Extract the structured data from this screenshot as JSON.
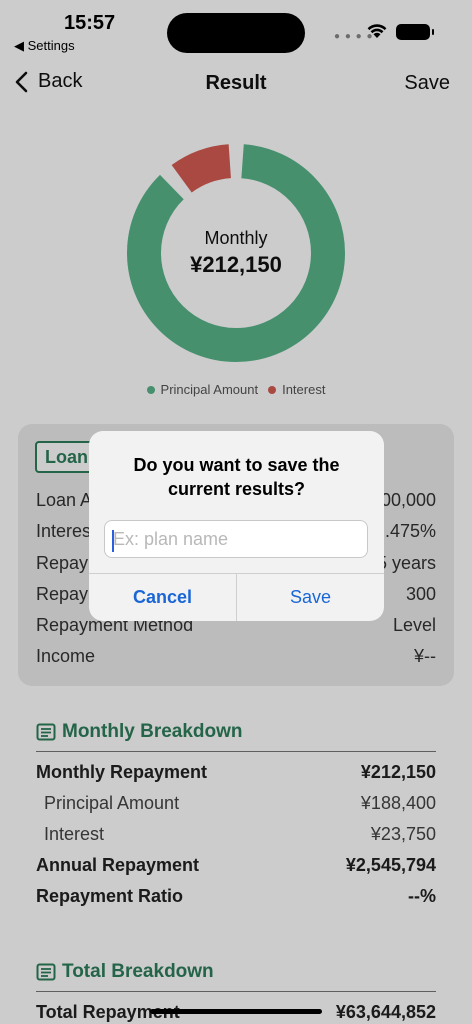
{
  "status": {
    "time": "15:57",
    "back_app": "◀ Settings"
  },
  "nav": {
    "back": "Back",
    "title": "Result",
    "save": "Save"
  },
  "donut": {
    "label": "Monthly",
    "value": "¥212,150",
    "principal_color": "#58b48a",
    "interest_color": "#d45c52",
    "principal_value": 188400,
    "interest_value": 23750
  },
  "legend": {
    "principal": "Principal Amount",
    "interest": "Interest"
  },
  "card": {
    "tag": "Loan",
    "rows": [
      {
        "label": "Loan A",
        "value": "00,000"
      },
      {
        "label": "Interes",
        "value": ".475%"
      },
      {
        "label": "Repay",
        "value": "5 years"
      },
      {
        "label": "Repay",
        "value": "300"
      },
      {
        "label": "Repayment Method",
        "value": "Level"
      },
      {
        "label": "Income",
        "value": "¥--"
      }
    ]
  },
  "monthly": {
    "title": "Monthly Breakdown",
    "rows": [
      {
        "label": "Monthly Repayment",
        "value": "¥212,150"
      },
      {
        "label": "Principal Amount",
        "value": "¥188,400"
      },
      {
        "label": "Interest",
        "value": "¥23,750"
      },
      {
        "label": "Annual Repayment",
        "value": "¥2,545,794"
      },
      {
        "label": "Repayment Ratio",
        "value": "--%"
      }
    ]
  },
  "total": {
    "title": "Total Breakdown",
    "rows": [
      {
        "label": "Total Repayment",
        "value": "¥63,644,852"
      }
    ]
  },
  "alert": {
    "title": "Do you want to save the current results?",
    "placeholder": "Ex: plan name",
    "cancel": "Cancel",
    "save": "Save"
  },
  "colors": {
    "accent": "#2e7d5c",
    "link": "#1a66d6"
  }
}
